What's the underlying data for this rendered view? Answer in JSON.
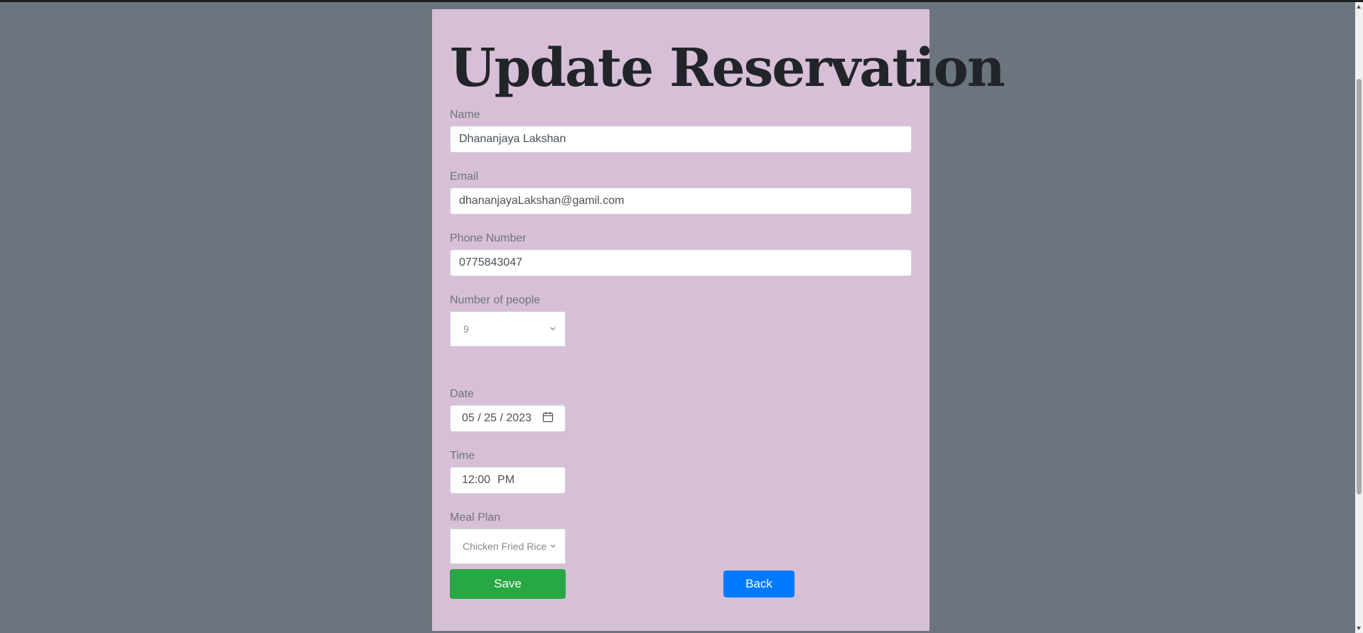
{
  "form": {
    "title": "Update Reservation",
    "name_label": "Name",
    "name_value": "Dhananjaya Lakshan",
    "email_label": "Email",
    "email_value": "dhananjayaLakshan@gamil.com",
    "phone_label": "Phone Number",
    "phone_value": "0775843047",
    "people_label": "Number of people",
    "people_value": "9",
    "date_label": "Date",
    "date_month": "05",
    "date_day": "25",
    "date_year": "2023",
    "time_label": "Time",
    "time_hour": "12",
    "time_minute": "00",
    "time_ampm": "PM",
    "meal_label": "Meal Plan",
    "meal_value": "Chicken Fried Rice",
    "save_label": "Save",
    "back_label": "Back"
  },
  "colors": {
    "page_bg": "#6c757d",
    "card_bg": "#d8bfd8",
    "save": "#28a745",
    "back": "#007bff"
  },
  "icons": {
    "date_picker": "calendar-icon",
    "select_caret": "chevron-down-icon"
  }
}
